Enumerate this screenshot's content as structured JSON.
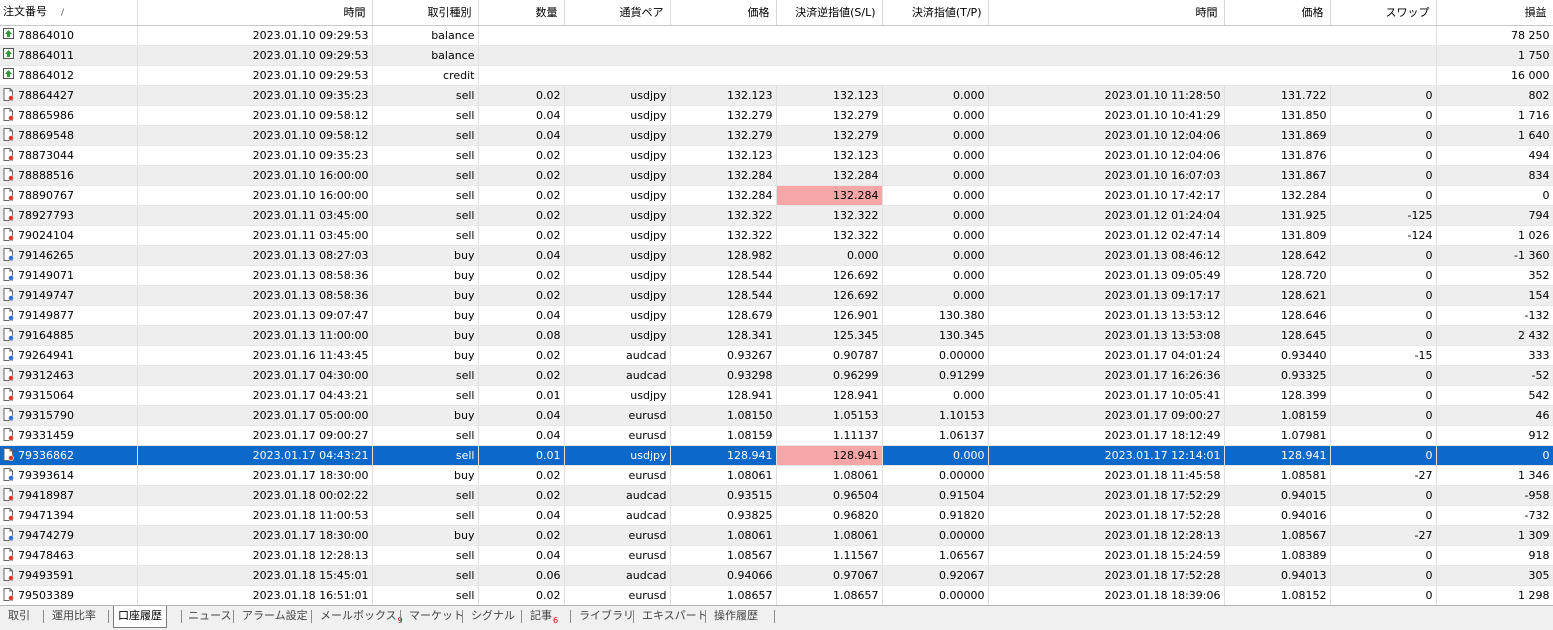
{
  "columns": {
    "ticket": "注文番号",
    "sort_mark": "/",
    "open_time": "時間",
    "type": "取引種別",
    "size": "数量",
    "symbol": "通貨ペア",
    "open_price": "価格",
    "sl": "決済逆指値(S/L)",
    "tp": "決済指値(T/P)",
    "close_time": "時間",
    "close_price": "価格",
    "swap": "スワップ",
    "profit": "損益"
  },
  "balance_rows": [
    {
      "ticket": "78864010",
      "open_time": "2023.01.10 09:29:53",
      "type": "balance",
      "profit": "78 250"
    },
    {
      "ticket": "78864011",
      "open_time": "2023.01.10 09:29:53",
      "type": "balance",
      "profit": "1 750"
    },
    {
      "ticket": "78864012",
      "open_time": "2023.01.10 09:29:53",
      "type": "credit",
      "profit": "16 000"
    }
  ],
  "trade_rows": [
    {
      "ticket": "78864427",
      "open_time": "2023.01.10 09:35:23",
      "type": "sell",
      "size": "0.02",
      "symbol": "usdjpy",
      "open_price": "132.123",
      "sl": "132.123",
      "tp": "0.000",
      "close_time": "2023.01.10 11:28:50",
      "close_price": "131.722",
      "swap": "0",
      "profit": "802"
    },
    {
      "ticket": "78865986",
      "open_time": "2023.01.10 09:58:12",
      "type": "sell",
      "size": "0.04",
      "symbol": "usdjpy",
      "open_price": "132.279",
      "sl": "132.279",
      "tp": "0.000",
      "close_time": "2023.01.10 10:41:29",
      "close_price": "131.850",
      "swap": "0",
      "profit": "1 716"
    },
    {
      "ticket": "78869548",
      "open_time": "2023.01.10 09:58:12",
      "type": "sell",
      "size": "0.04",
      "symbol": "usdjpy",
      "open_price": "132.279",
      "sl": "132.279",
      "tp": "0.000",
      "close_time": "2023.01.10 12:04:06",
      "close_price": "131.869",
      "swap": "0",
      "profit": "1 640"
    },
    {
      "ticket": "78873044",
      "open_time": "2023.01.10 09:35:23",
      "type": "sell",
      "size": "0.02",
      "symbol": "usdjpy",
      "open_price": "132.123",
      "sl": "132.123",
      "tp": "0.000",
      "close_time": "2023.01.10 12:04:06",
      "close_price": "131.876",
      "swap": "0",
      "profit": "494"
    },
    {
      "ticket": "78888516",
      "open_time": "2023.01.10 16:00:00",
      "type": "sell",
      "size": "0.02",
      "symbol": "usdjpy",
      "open_price": "132.284",
      "sl": "132.284",
      "tp": "0.000",
      "close_time": "2023.01.10 16:07:03",
      "close_price": "131.867",
      "swap": "0",
      "profit": "834"
    },
    {
      "ticket": "78890767",
      "open_time": "2023.01.10 16:00:00",
      "type": "sell",
      "size": "0.02",
      "symbol": "usdjpy",
      "open_price": "132.284",
      "sl": "132.284",
      "tp": "0.000",
      "close_time": "2023.01.10 17:42:17",
      "close_price": "132.284",
      "swap": "0",
      "profit": "0",
      "sl_hit": true
    },
    {
      "ticket": "78927793",
      "open_time": "2023.01.11 03:45:00",
      "type": "sell",
      "size": "0.02",
      "symbol": "usdjpy",
      "open_price": "132.322",
      "sl": "132.322",
      "tp": "0.000",
      "close_time": "2023.01.12 01:24:04",
      "close_price": "131.925",
      "swap": "-125",
      "profit": "794"
    },
    {
      "ticket": "79024104",
      "open_time": "2023.01.11 03:45:00",
      "type": "sell",
      "size": "0.02",
      "symbol": "usdjpy",
      "open_price": "132.322",
      "sl": "132.322",
      "tp": "0.000",
      "close_time": "2023.01.12 02:47:14",
      "close_price": "131.809",
      "swap": "-124",
      "profit": "1 026"
    },
    {
      "ticket": "79146265",
      "open_time": "2023.01.13 08:27:03",
      "type": "buy",
      "size": "0.04",
      "symbol": "usdjpy",
      "open_price": "128.982",
      "sl": "0.000",
      "tp": "0.000",
      "close_time": "2023.01.13 08:46:12",
      "close_price": "128.642",
      "swap": "0",
      "profit": "-1 360"
    },
    {
      "ticket": "79149071",
      "open_time": "2023.01.13 08:58:36",
      "type": "buy",
      "size": "0.02",
      "symbol": "usdjpy",
      "open_price": "128.544",
      "sl": "126.692",
      "tp": "0.000",
      "close_time": "2023.01.13 09:05:49",
      "close_price": "128.720",
      "swap": "0",
      "profit": "352"
    },
    {
      "ticket": "79149747",
      "open_time": "2023.01.13 08:58:36",
      "type": "buy",
      "size": "0.02",
      "symbol": "usdjpy",
      "open_price": "128.544",
      "sl": "126.692",
      "tp": "0.000",
      "close_time": "2023.01.13 09:17:17",
      "close_price": "128.621",
      "swap": "0",
      "profit": "154"
    },
    {
      "ticket": "79149877",
      "open_time": "2023.01.13 09:07:47",
      "type": "buy",
      "size": "0.04",
      "symbol": "usdjpy",
      "open_price": "128.679",
      "sl": "126.901",
      "tp": "130.380",
      "close_time": "2023.01.13 13:53:12",
      "close_price": "128.646",
      "swap": "0",
      "profit": "-132"
    },
    {
      "ticket": "79164885",
      "open_time": "2023.01.13 11:00:00",
      "type": "buy",
      "size": "0.08",
      "symbol": "usdjpy",
      "open_price": "128.341",
      "sl": "125.345",
      "tp": "130.345",
      "close_time": "2023.01.13 13:53:08",
      "close_price": "128.645",
      "swap": "0",
      "profit": "2 432"
    },
    {
      "ticket": "79264941",
      "open_time": "2023.01.16 11:43:45",
      "type": "buy",
      "size": "0.02",
      "symbol": "audcad",
      "open_price": "0.93267",
      "sl": "0.90787",
      "tp": "0.00000",
      "close_time": "2023.01.17 04:01:24",
      "close_price": "0.93440",
      "swap": "-15",
      "profit": "333"
    },
    {
      "ticket": "79312463",
      "open_time": "2023.01.17 04:30:00",
      "type": "sell",
      "size": "0.02",
      "symbol": "audcad",
      "open_price": "0.93298",
      "sl": "0.96299",
      "tp": "0.91299",
      "close_time": "2023.01.17 16:26:36",
      "close_price": "0.93325",
      "swap": "0",
      "profit": "-52"
    },
    {
      "ticket": "79315064",
      "open_time": "2023.01.17 04:43:21",
      "type": "sell",
      "size": "0.01",
      "symbol": "usdjpy",
      "open_price": "128.941",
      "sl": "128.941",
      "tp": "0.000",
      "close_time": "2023.01.17 10:05:41",
      "close_price": "128.399",
      "swap": "0",
      "profit": "542"
    },
    {
      "ticket": "79315790",
      "open_time": "2023.01.17 05:00:00",
      "type": "buy",
      "size": "0.04",
      "symbol": "eurusd",
      "open_price": "1.08150",
      "sl": "1.05153",
      "tp": "1.10153",
      "close_time": "2023.01.17 09:00:27",
      "close_price": "1.08159",
      "swap": "0",
      "profit": "46"
    },
    {
      "ticket": "79331459",
      "open_time": "2023.01.17 09:00:27",
      "type": "sell",
      "size": "0.04",
      "symbol": "eurusd",
      "open_price": "1.08159",
      "sl": "1.11137",
      "tp": "1.06137",
      "close_time": "2023.01.17 18:12:49",
      "close_price": "1.07981",
      "swap": "0",
      "profit": "912"
    },
    {
      "ticket": "79336862",
      "open_time": "2023.01.17 04:43:21",
      "type": "sell",
      "size": "0.01",
      "symbol": "usdjpy",
      "open_price": "128.941",
      "sl": "128.941",
      "tp": "0.000",
      "close_time": "2023.01.17 12:14:01",
      "close_price": "128.941",
      "swap": "0",
      "profit": "0",
      "sl_hit": true,
      "selected": true
    },
    {
      "ticket": "79393614",
      "open_time": "2023.01.17 18:30:00",
      "type": "buy",
      "size": "0.02",
      "symbol": "eurusd",
      "open_price": "1.08061",
      "sl": "1.08061",
      "tp": "0.00000",
      "close_time": "2023.01.18 11:45:58",
      "close_price": "1.08581",
      "swap": "-27",
      "profit": "1 346"
    },
    {
      "ticket": "79418987",
      "open_time": "2023.01.18 00:02:22",
      "type": "sell",
      "size": "0.02",
      "symbol": "audcad",
      "open_price": "0.93515",
      "sl": "0.96504",
      "tp": "0.91504",
      "close_time": "2023.01.18 17:52:29",
      "close_price": "0.94015",
      "swap": "0",
      "profit": "-958"
    },
    {
      "ticket": "79471394",
      "open_time": "2023.01.18 11:00:53",
      "type": "sell",
      "size": "0.04",
      "symbol": "audcad",
      "open_price": "0.93825",
      "sl": "0.96820",
      "tp": "0.91820",
      "close_time": "2023.01.18 17:52:28",
      "close_price": "0.94016",
      "swap": "0",
      "profit": "-732"
    },
    {
      "ticket": "79474279",
      "open_time": "2023.01.17 18:30:00",
      "type": "buy",
      "size": "0.02",
      "symbol": "eurusd",
      "open_price": "1.08061",
      "sl": "1.08061",
      "tp": "0.00000",
      "close_time": "2023.01.18 12:28:13",
      "close_price": "1.08567",
      "swap": "-27",
      "profit": "1 309"
    },
    {
      "ticket": "79478463",
      "open_time": "2023.01.18 12:28:13",
      "type": "sell",
      "size": "0.04",
      "symbol": "eurusd",
      "open_price": "1.08567",
      "sl": "1.11567",
      "tp": "1.06567",
      "close_time": "2023.01.18 15:24:59",
      "close_price": "1.08389",
      "swap": "0",
      "profit": "918"
    },
    {
      "ticket": "79493591",
      "open_time": "2023.01.18 15:45:01",
      "type": "sell",
      "size": "0.06",
      "symbol": "audcad",
      "open_price": "0.94066",
      "sl": "0.97067",
      "tp": "0.92067",
      "close_time": "2023.01.18 17:52:28",
      "close_price": "0.94013",
      "swap": "0",
      "profit": "305"
    },
    {
      "ticket": "79503389",
      "open_time": "2023.01.18 16:51:01",
      "type": "sell",
      "size": "0.02",
      "symbol": "eurusd",
      "open_price": "1.08657",
      "sl": "1.08657",
      "tp": "0.00000",
      "close_time": "2023.01.18 18:39:06",
      "close_price": "1.08152",
      "swap": "0",
      "profit": "1 298"
    }
  ],
  "tabs": [
    {
      "id": "trade",
      "label": "取引"
    },
    {
      "id": "exposure",
      "label": "運用比率"
    },
    {
      "id": "account-history",
      "label": "口座履歴",
      "active": true
    },
    {
      "id": "news",
      "label": "ニュース"
    },
    {
      "id": "alerts",
      "label": "アラーム設定"
    },
    {
      "id": "mailbox",
      "label": "メールボックス",
      "badge": "9"
    },
    {
      "id": "market",
      "label": "マーケット"
    },
    {
      "id": "signals",
      "label": "シグナル"
    },
    {
      "id": "articles",
      "label": "記事",
      "badge": "6"
    },
    {
      "id": "library",
      "label": "ライブラリ"
    },
    {
      "id": "experts",
      "label": "エキスパート"
    },
    {
      "id": "journal",
      "label": "操作履歴"
    }
  ],
  "colors": {
    "selection": "#0c68c9",
    "sl_highlight": "#f6a6a6",
    "buy_icon": "#2d6fd6",
    "sell_icon": "#d83a2a",
    "balance_icon": "#2f9b35"
  },
  "icons": {
    "balance": "balance-arrow-icon",
    "buy": "buy-order-icon",
    "sell": "sell-order-icon"
  }
}
